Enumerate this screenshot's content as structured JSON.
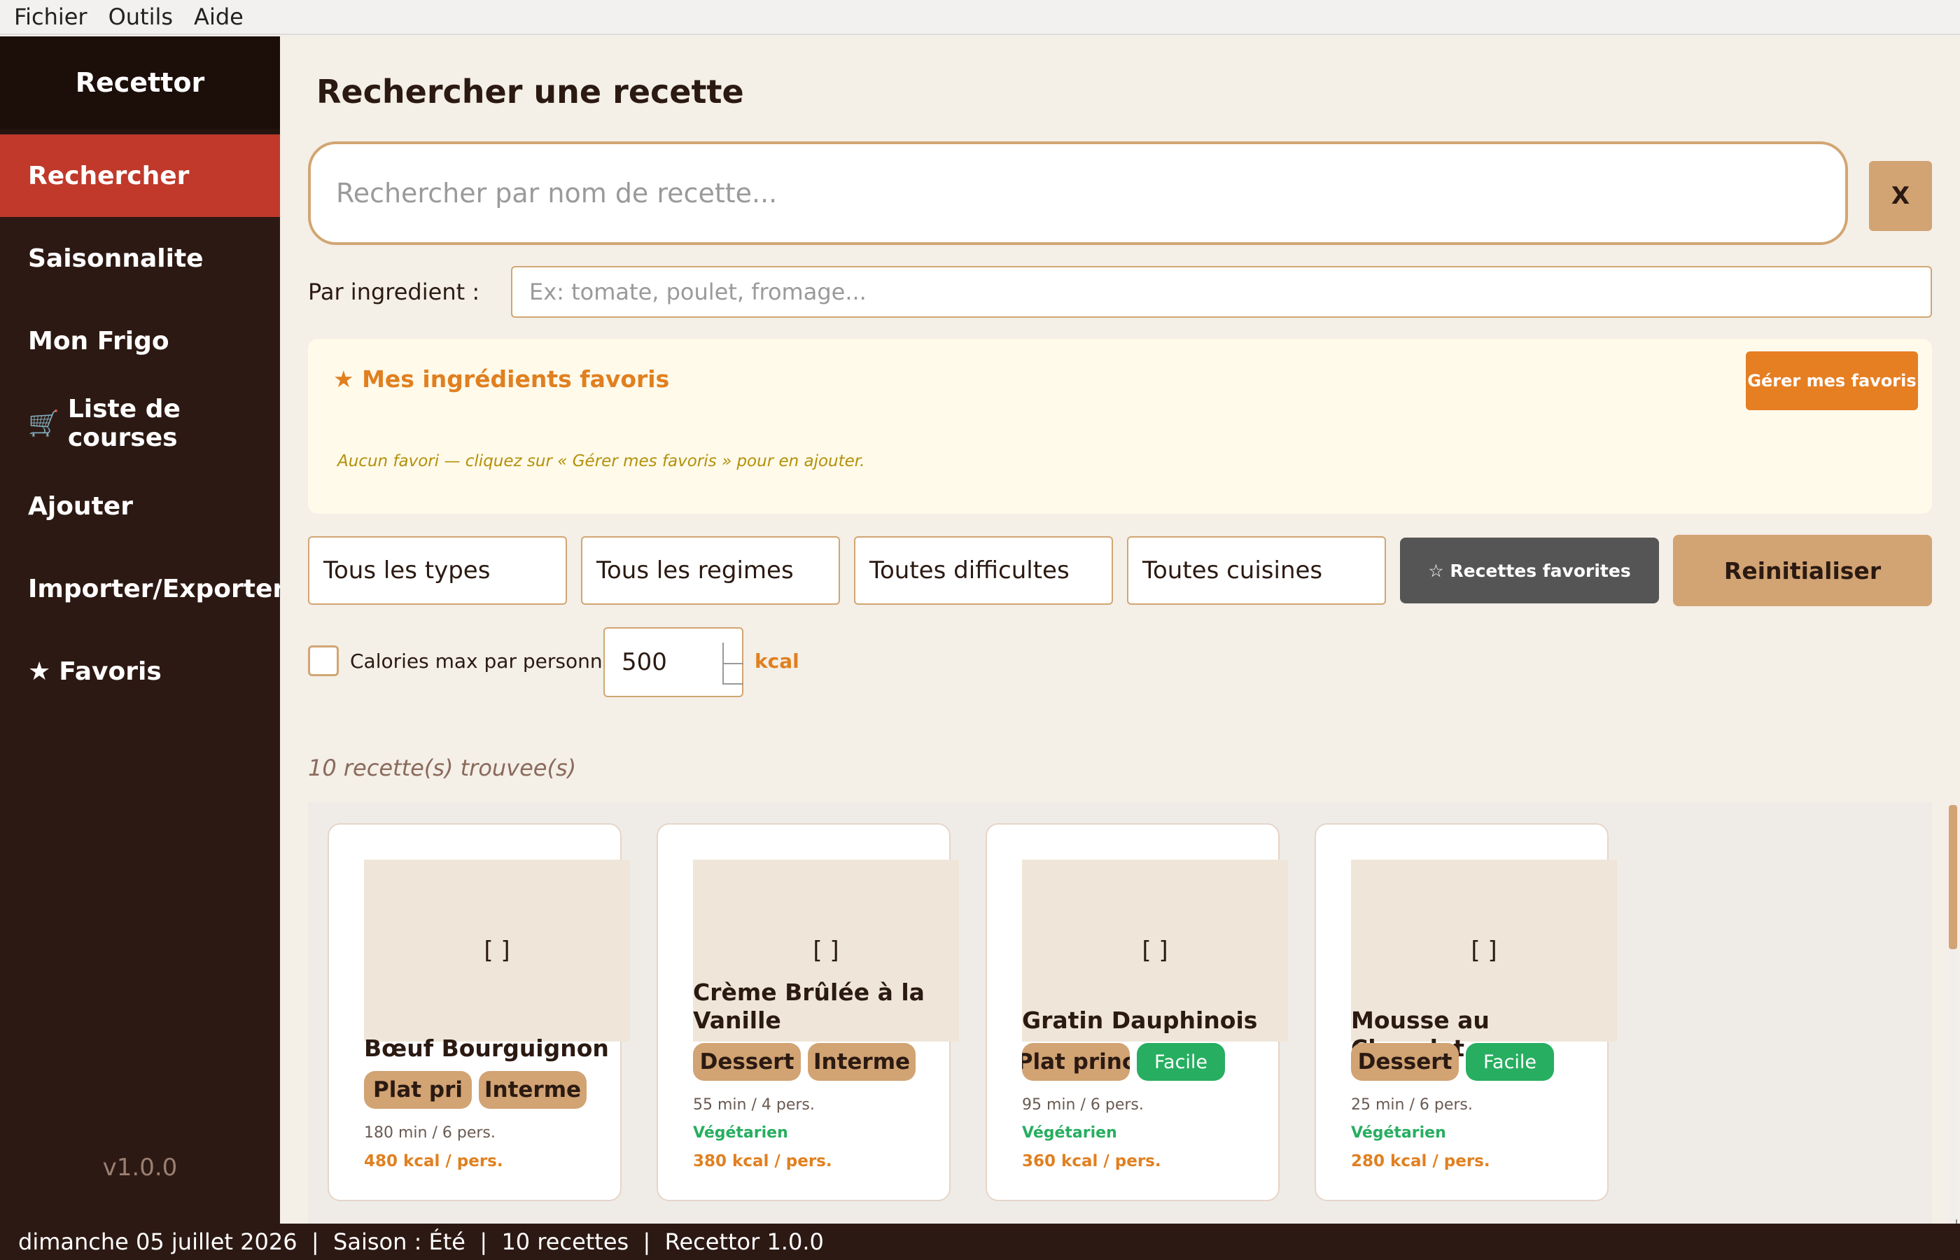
{
  "menubar": {
    "items": [
      "Fichier",
      "Outils",
      "Aide"
    ]
  },
  "sidebar": {
    "brand": "Recettor",
    "items": [
      {
        "label": "Rechercher",
        "icon": ""
      },
      {
        "label": "Saisonnalite",
        "icon": ""
      },
      {
        "label": "Mon Frigo",
        "icon": ""
      },
      {
        "label": "Liste de courses",
        "icon": "🛒"
      },
      {
        "label": "Ajouter",
        "icon": ""
      },
      {
        "label": "Importer/Exporter",
        "icon": ""
      },
      {
        "label": "Favoris",
        "icon": "★"
      }
    ],
    "version": "v1.0.0"
  },
  "main": {
    "title": "Rechercher une recette",
    "search": {
      "placeholder": "Rechercher par nom de recette...",
      "value": ""
    },
    "clear_label": "X",
    "ingredient": {
      "label": "Par ingredient :",
      "placeholder": "Ex: tomate, poulet, fromage...",
      "value": ""
    },
    "favorites": {
      "title": "★ Mes ingrédients favoris",
      "manage_label": "Gérer mes favoris",
      "empty_text": "Aucun favori — cliquez sur « Gérer mes favoris » pour en ajouter."
    },
    "filters": {
      "type": "Tous les types",
      "regime": "Tous les regimes",
      "difficulty": "Toutes difficultes",
      "cuisine": "Toutes cuisines"
    },
    "favorite_recipes_label": "☆ Recettes favorites",
    "reset_label": "Reinitialiser",
    "calories": {
      "label": "Calories max par personne :",
      "value": "500",
      "unit": "kcal",
      "checked": false
    },
    "result_count": "10 recette(s) trouvee(s)",
    "cards": [
      {
        "placeholder": "[ ]",
        "title": "Bœuf Bourguignon",
        "tags": [
          "Plat pri",
          "Interme"
        ],
        "meta": "180 min  /  6 pers.",
        "veg": "",
        "kcal": "480 kcal / pers."
      },
      {
        "placeholder": "[ ]",
        "title": "Crème Brûlée à la Vanille",
        "tags": [
          "Dessert",
          "Interme"
        ],
        "meta": "55 min  /  4 pers.",
        "veg": "Végétarien",
        "kcal": "380 kcal / pers."
      },
      {
        "placeholder": "[ ]",
        "title": "Gratin Dauphinois",
        "tags": [
          "Plat princ",
          "Facile"
        ],
        "meta": "95 min  /  6 pers.",
        "veg": "Végétarien",
        "kcal": "360 kcal / pers."
      },
      {
        "placeholder": "[ ]",
        "title": "Mousse au Chocolat",
        "tags": [
          "Dessert",
          "Facile"
        ],
        "meta": "25 min  /  6 pers.",
        "veg": "Végétarien",
        "kcal": "280 kcal / pers."
      }
    ]
  },
  "statusbar": {
    "text": "dimanche 05 juillet 2026  |  Saison : Été  |  10 recettes  |  Recettor 1.0.0"
  }
}
